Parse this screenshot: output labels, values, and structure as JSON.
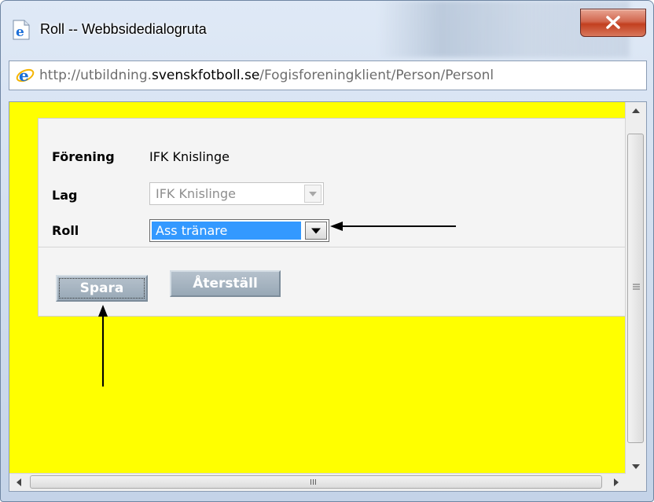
{
  "window": {
    "title": "Roll -- Webbsidedialogruta",
    "close_label": "x"
  },
  "address": {
    "url_prefix": "http://utbildning.",
    "url_host": "svenskfotboll.se",
    "url_path": "/Fogisforeningklient/Person/Personl"
  },
  "form": {
    "forening_label": "Förening",
    "forening_value": "IFK Knislinge",
    "lag_label": "Lag",
    "lag_value": "IFK Knislinge",
    "roll_label": "Roll",
    "roll_value": "Ass tränare",
    "save_label": "Spara",
    "reset_label": "Återställ"
  },
  "scrollbar": {
    "h_grip": "III"
  },
  "colors": {
    "page_background": "#ffff00",
    "selected_option": "#3399ff",
    "close_button": "#c23f1f"
  },
  "icons": {
    "app": "ie-page-icon",
    "address": "ie-logo-icon",
    "annotations": "arrow-icon"
  }
}
